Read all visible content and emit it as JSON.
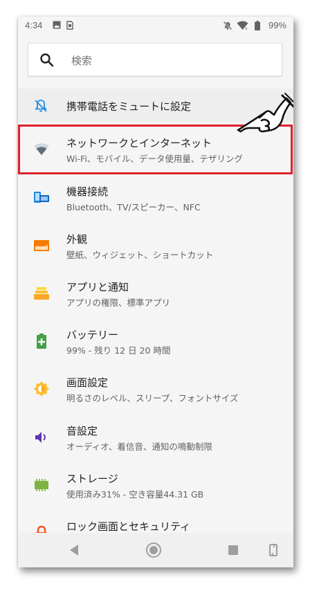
{
  "status": {
    "time": "4:34",
    "battery": "99%"
  },
  "search": {
    "placeholder": "検索"
  },
  "suggestion": {
    "label": "携帯電話をミュートに設定",
    "icon": "bell-off-icon"
  },
  "items": [
    {
      "title": "ネットワークとインターネット",
      "sub": "Wi-Fi、モバイル、データ使用量、テザリング",
      "icon": "wifi-icon",
      "color": "#5f6368"
    },
    {
      "title": "機器接続",
      "sub": "Bluetooth、TV/スピーカー、NFC",
      "icon": "devices-icon",
      "color": "#1e88e5"
    },
    {
      "title": "外観",
      "sub": "壁紙、ウィジェット、ショートカット",
      "icon": "wallpaper-icon",
      "color": "#f57c00"
    },
    {
      "title": "アプリと通知",
      "sub": "アプリの権限、標準アプリ",
      "icon": "apps-icon",
      "color": "#fbc02d"
    },
    {
      "title": "バッテリー",
      "sub": "99% - 残り 12 日 20 時間",
      "icon": "battery-icon",
      "color": "#43a047"
    },
    {
      "title": "画面設定",
      "sub": "明るさのレベル、スリープ、フォントサイズ",
      "icon": "brightness-icon",
      "color": "#fbc02d"
    },
    {
      "title": "音設定",
      "sub": "オーディオ、着信音、通知の鳴動制限",
      "icon": "volume-icon",
      "color": "#5e35b1"
    },
    {
      "title": "ストレージ",
      "sub": "使用済み31% - 空き容量44.31 GB",
      "icon": "storage-icon",
      "color": "#7cb342"
    },
    {
      "title": "ロック画面とセキュリティ",
      "sub": "",
      "icon": "lock-icon",
      "color": "#f4511e"
    }
  ],
  "colors": {
    "highlight": "#e0202a",
    "background": "#f5f5f5"
  }
}
